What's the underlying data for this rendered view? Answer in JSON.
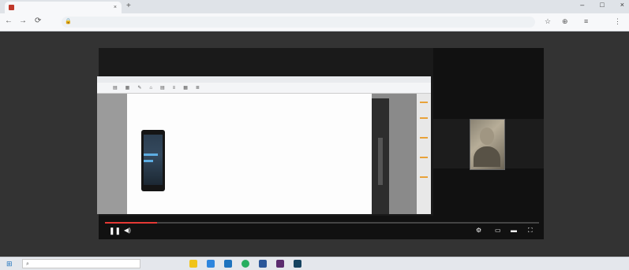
{
  "browser": {
    "tab_title": "",
    "tab_close": "×",
    "new_tab": "+",
    "window_controls": [
      "–",
      "□",
      "×"
    ],
    "nav": {
      "back": "←",
      "forward": "→",
      "reload": "⟳"
    },
    "url": "",
    "extensions": [
      "☆",
      "⊕",
      "≡",
      "⋮"
    ]
  },
  "player": {
    "document": {
      "text_heading": "",
      "list_items": []
    },
    "progress_fraction": 0.12,
    "time_display": "",
    "controls": {
      "play_pause": "❚❚",
      "volume": "◀)",
      "settings": "⚙",
      "miniplayer": "▭",
      "theater": "▬",
      "fullscreen": "⛶"
    }
  },
  "taskbar": {
    "start": "⊞",
    "search_placeholder": "",
    "search_icon": "⌕",
    "tray_weather": "",
    "tray_time": ""
  },
  "colors": {
    "progress": "#e53935",
    "accent": "#1e73be"
  }
}
